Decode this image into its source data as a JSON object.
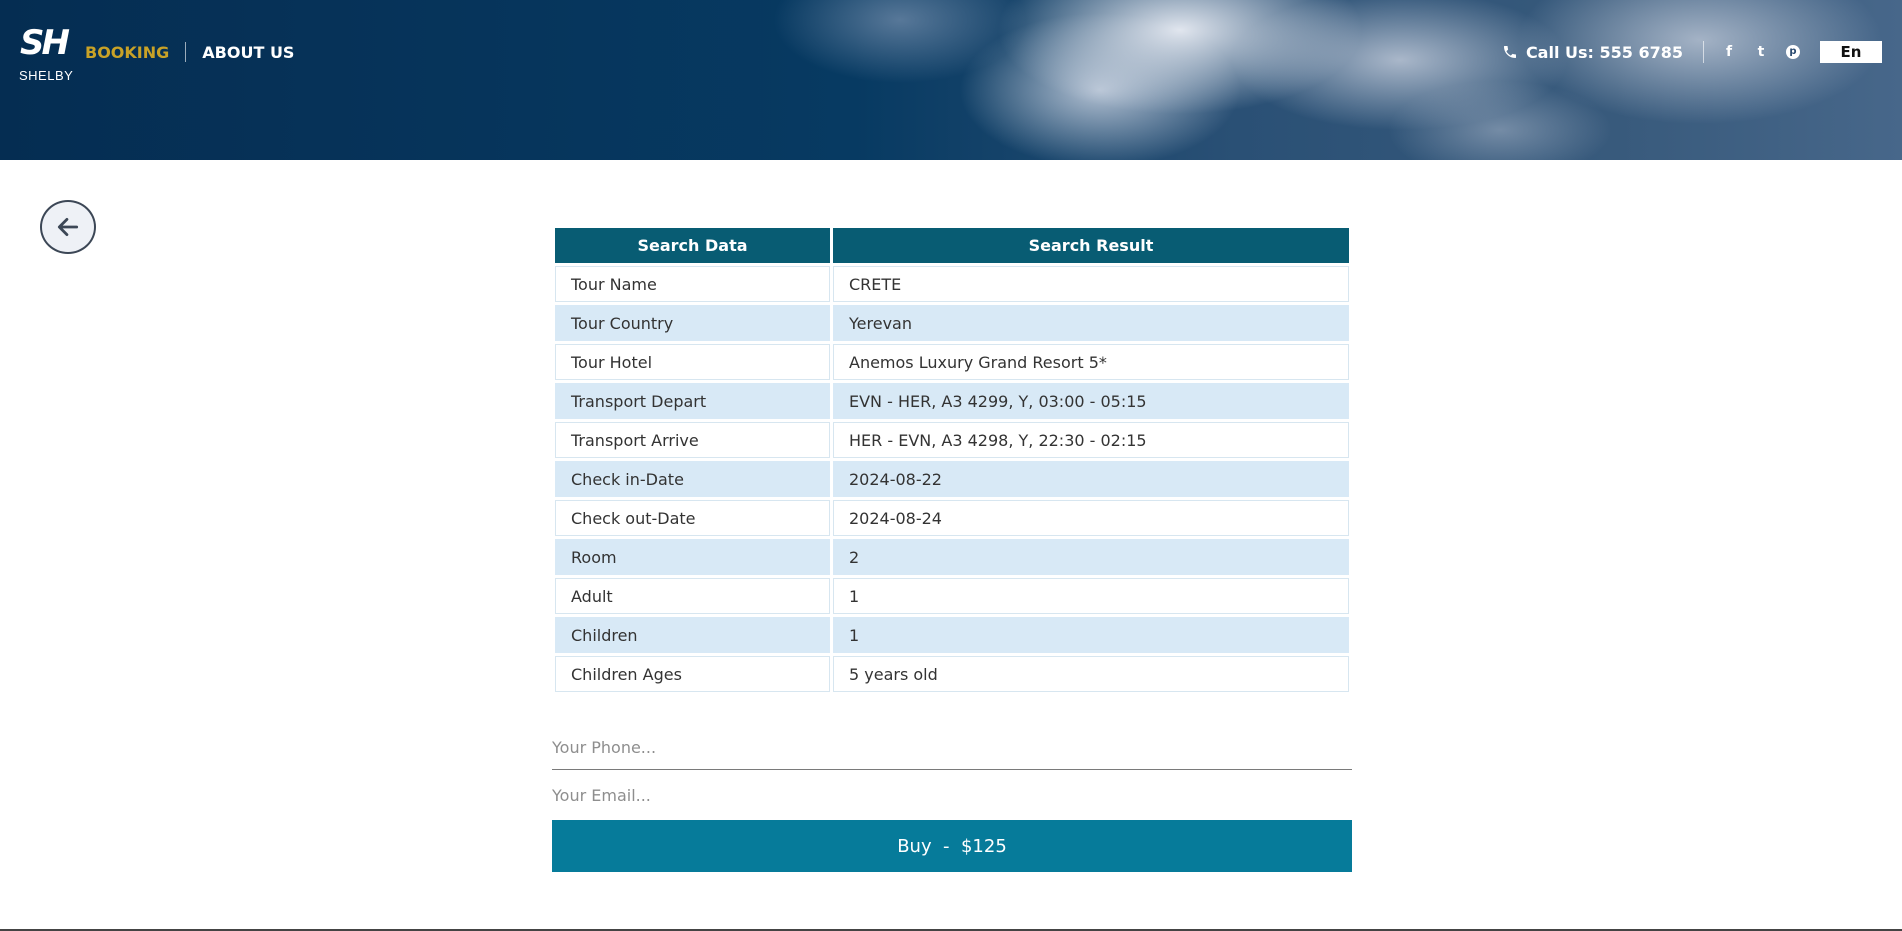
{
  "header": {
    "logo_mark": "SH",
    "logo_text": "SHELBY",
    "nav": {
      "booking": "BOOKING",
      "about": "ABOUT US"
    },
    "call": "Call Us: 555 6785",
    "social": {
      "facebook": "f",
      "twitter": "t",
      "pinterest": "p"
    },
    "language": "En"
  },
  "colors": {
    "accent_gold": "#c9a227",
    "table_header": "#085c73",
    "row_alt": "#d8e9f6",
    "buy_button": "#067b9a"
  },
  "icons": {
    "back": "arrow-left-icon",
    "phone": "phone-icon",
    "facebook": "facebook-icon",
    "twitter": "twitter-icon",
    "pinterest": "pinterest-icon"
  },
  "table": {
    "headers": [
      "Search Data",
      "Search Result"
    ],
    "rows": [
      {
        "label": "Tour Name",
        "value": "CRETE"
      },
      {
        "label": "Tour Country",
        "value": "Yerevan"
      },
      {
        "label": "Tour Hotel",
        "value": "Anemos Luxury Grand Resort 5*"
      },
      {
        "label": "Transport Depart",
        "value": "EVN - HER, A3 4299, Y, 03:00 - 05:15"
      },
      {
        "label": "Transport Arrive",
        "value": "HER - EVN, A3 4298, Y, 22:30 - 02:15"
      },
      {
        "label": "Check in-Date",
        "value": "2024-08-22"
      },
      {
        "label": "Check out-Date",
        "value": "2024-08-24"
      },
      {
        "label": "Room",
        "value": "2"
      },
      {
        "label": "Adult",
        "value": "1"
      },
      {
        "label": "Children",
        "value": "1"
      },
      {
        "label": "Children Ages",
        "value": "5 years old"
      }
    ]
  },
  "form": {
    "phone_placeholder": "Your Phone...",
    "email_placeholder": "Your Email...",
    "buy_label": "Buy  -  $125"
  }
}
